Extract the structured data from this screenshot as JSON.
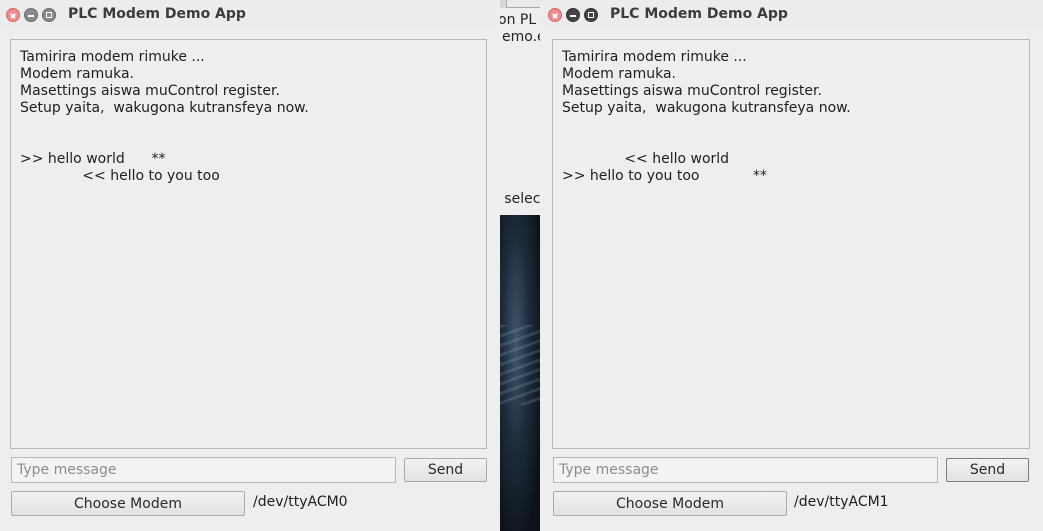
{
  "background_terminal": {
    "lines": [
      "on PL",
      "emo.e",
      "' selec"
    ]
  },
  "windows": [
    {
      "title": "PLC Modem Demo App",
      "log_lines": [
        "Tamirira modem rimuke ...",
        "Modem ramuka.",
        "Masettings aiswa muControl register.",
        "Setup yaita,  wakugona kutransfeya now.",
        "",
        "",
        ">> hello world      **",
        "              << hello to you too"
      ],
      "message_placeholder": "Type message",
      "message_value": "",
      "send_label": "Send",
      "choose_modem_label": "Choose Modem",
      "device": "/dev/ttyACM0"
    },
    {
      "title": "PLC Modem Demo App",
      "log_lines": [
        "Tamirira modem rimuke ...",
        "Modem ramuka.",
        "Masettings aiswa muControl register.",
        "Setup yaita,  wakugona kutransfeya now.",
        "",
        "",
        "              << hello world",
        ">> hello to you too            **"
      ],
      "message_placeholder": "Type message",
      "message_value": "",
      "send_label": "Send",
      "choose_modem_label": "Choose Modem",
      "device": "/dev/ttyACM1"
    }
  ]
}
